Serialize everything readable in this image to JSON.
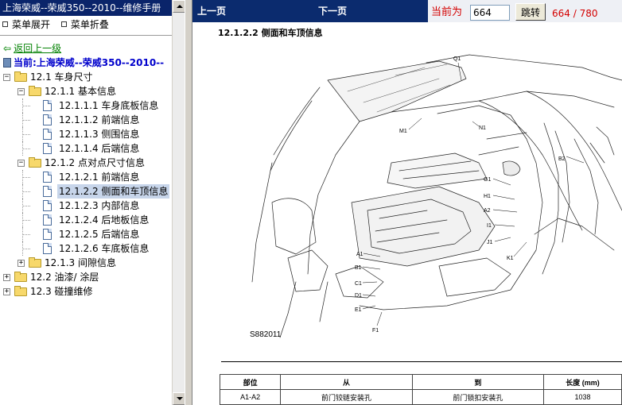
{
  "left": {
    "title": "上海荣威--荣威350--2010--维修手册",
    "expand_label": "菜单展开",
    "collapse_label": "菜单折叠",
    "back_label": "返回上一级",
    "current_label": "当前:上海荣威--荣威350--2010--"
  },
  "tree": [
    {
      "label": "12.1 车身尺寸",
      "level": 0,
      "type": "folder",
      "toggle": "−"
    },
    {
      "label": "12.1.1 基本信息",
      "level": 1,
      "type": "folder",
      "toggle": "−"
    },
    {
      "label": "12.1.1.1 车身底板信息",
      "level": 2,
      "type": "doc"
    },
    {
      "label": "12.1.1.2 前端信息",
      "level": 2,
      "type": "doc"
    },
    {
      "label": "12.1.1.3 侧围信息",
      "level": 2,
      "type": "doc"
    },
    {
      "label": "12.1.1.4 后端信息",
      "level": 2,
      "type": "doc"
    },
    {
      "label": "12.1.2 点对点尺寸信息",
      "level": 1,
      "type": "folder",
      "toggle": "−"
    },
    {
      "label": "12.1.2.1 前端信息",
      "level": 2,
      "type": "doc"
    },
    {
      "label": "12.1.2.2 侧面和车顶信息",
      "level": 2,
      "type": "doc",
      "selected": true
    },
    {
      "label": "12.1.2.3 内部信息",
      "level": 2,
      "type": "doc"
    },
    {
      "label": "12.1.2.4 后地板信息",
      "level": 2,
      "type": "doc"
    },
    {
      "label": "12.1.2.5 后端信息",
      "level": 2,
      "type": "doc"
    },
    {
      "label": "12.1.2.6 车底板信息",
      "level": 2,
      "type": "doc"
    },
    {
      "label": "12.1.3 间隙信息",
      "level": 1,
      "type": "folder",
      "toggle": "+"
    },
    {
      "label": "12.2 油漆/ 涂层",
      "level": 0,
      "type": "folder",
      "toggle": "+"
    },
    {
      "label": "12.3 碰撞维修",
      "level": 0,
      "type": "folder",
      "toggle": "+"
    }
  ],
  "nav": {
    "prev_label": "上一页",
    "next_label": "下一页",
    "current_page_label": "当前为",
    "page_value": "664",
    "jump_label": "跳转",
    "page_count": "664 / 780"
  },
  "doc": {
    "section_title": "12.1.2.2 侧面和车顶信息",
    "figure_code": "S882011",
    "figure_labels": [
      "Q1",
      "M1",
      "N1",
      "B2",
      "G1",
      "H1",
      "A2",
      "I1",
      "J1",
      "K1",
      "A1",
      "B1",
      "C1",
      "D1",
      "E1",
      "F1"
    ],
    "table": {
      "headers": [
        "部位",
        "从",
        "到",
        "长度 (mm)"
      ],
      "rows": [
        [
          "A1-A2",
          "前门铰链安装孔",
          "前门锁扣安装孔",
          "1038"
        ]
      ]
    }
  },
  "colors": {
    "title_bar": "#0a246a",
    "nav_bar": "#0b2b6e",
    "link_green": "#008000",
    "current_blue": "#0000cc",
    "page_red": "#d40000",
    "selection": "#c7d5ea"
  }
}
